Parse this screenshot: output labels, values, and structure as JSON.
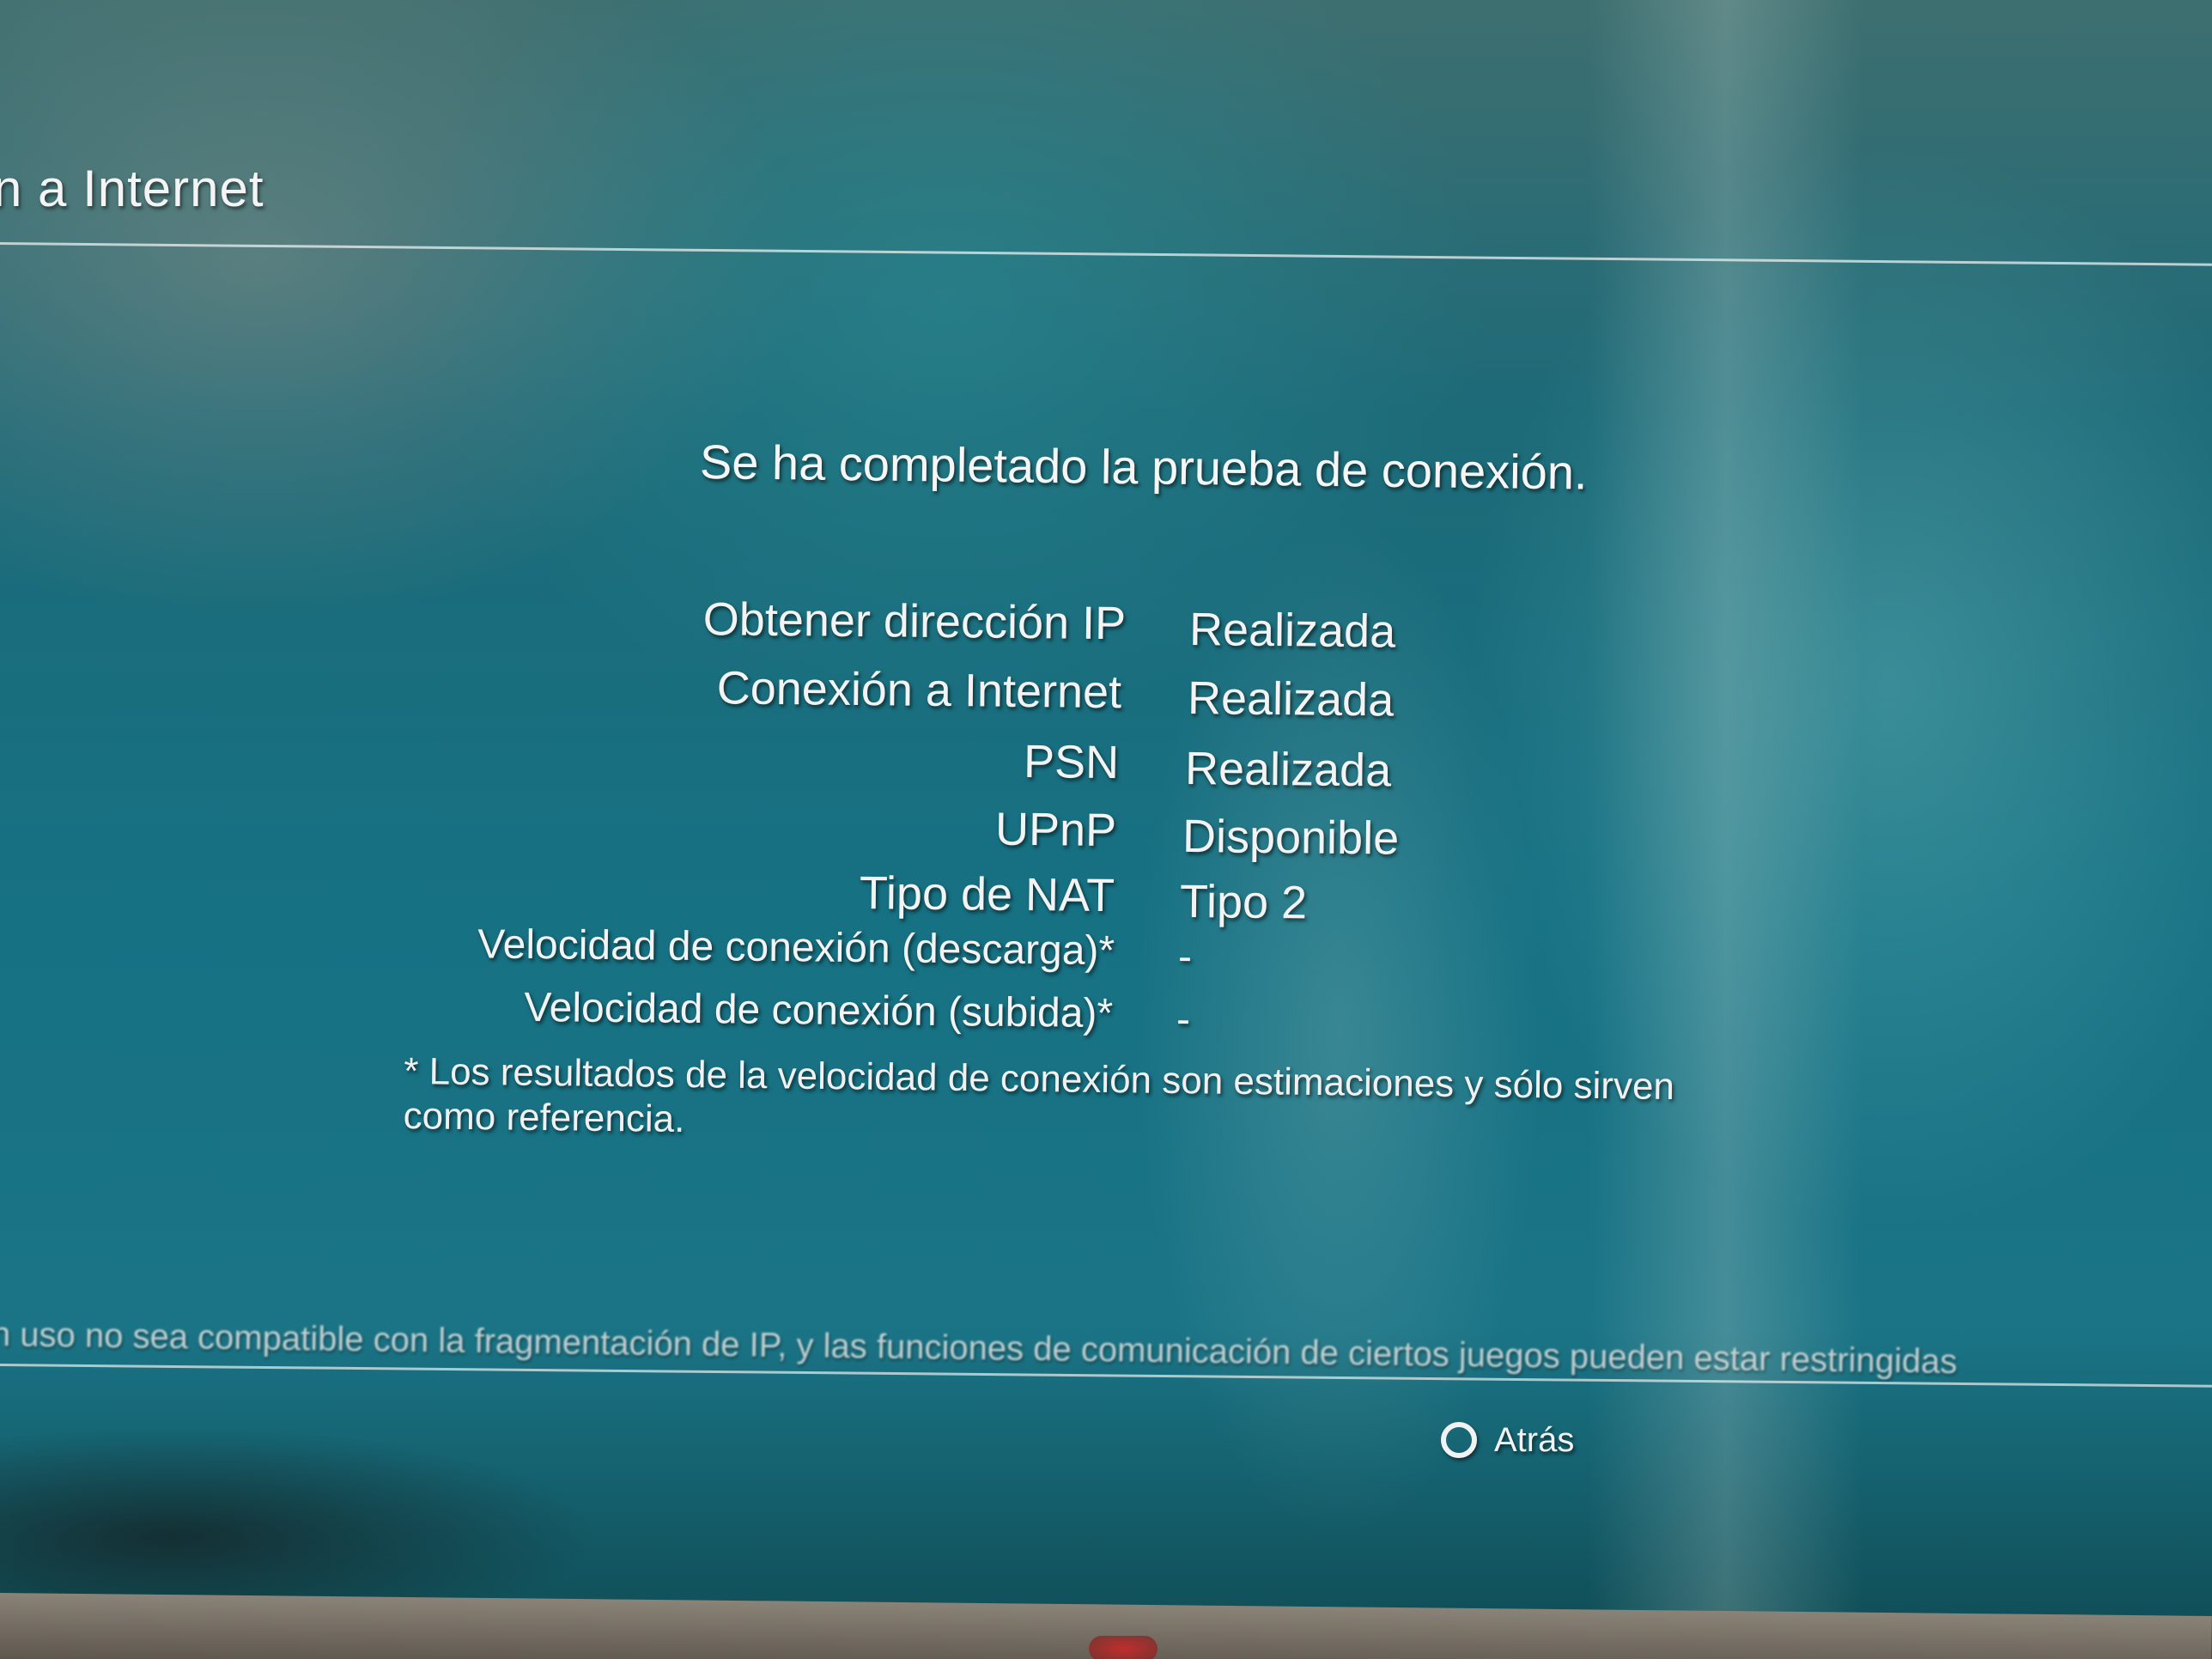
{
  "header": {
    "title": "n a Internet"
  },
  "main": {
    "message": "Se ha completado la prueba de conexión.",
    "results": [
      {
        "label": "Obtener dirección IP",
        "value": "Realizada"
      },
      {
        "label": "Conexión a Internet",
        "value": "Realizada"
      },
      {
        "label": "PSN",
        "value": "Realizada"
      },
      {
        "label": "UPnP",
        "value": "Disponible"
      },
      {
        "label": "Tipo de NAT",
        "value": "Tipo 2"
      },
      {
        "label": "Velocidad de conexión (descarga)*",
        "value": "-"
      },
      {
        "label": "Velocidad de conexión (subida)*",
        "value": "-"
      }
    ],
    "footnote_line1": "* Los resultados de la velocidad de conexión son estimaciones y sólo sirven",
    "footnote_line2": "como referencia."
  },
  "warning": {
    "text": "n uso no sea compatible con la fragmentación de IP, y las funciones de comunicación de ciertos juegos pueden estar restringidas"
  },
  "footer": {
    "back_label": "Atrás",
    "back_icon": "circle-button-icon"
  }
}
